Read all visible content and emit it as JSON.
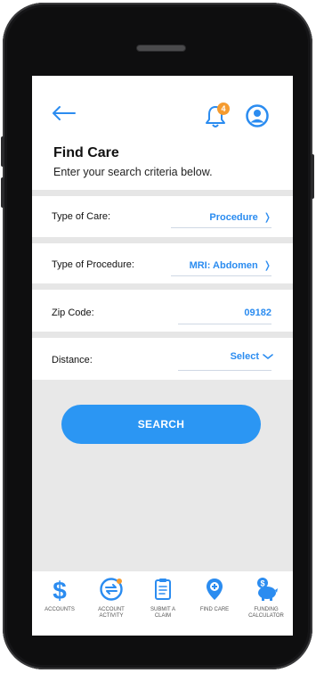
{
  "header": {
    "notification_count": "4",
    "title": "Find Care",
    "subtitle": "Enter your search criteria below."
  },
  "form": {
    "rows": [
      {
        "label": "Type of Care:",
        "value": "Procedure"
      },
      {
        "label": "Type of Procedure:",
        "value": "MRI: Abdomen"
      },
      {
        "label": "Zip Code:",
        "value": "09182"
      },
      {
        "label": "Distance:",
        "value": "Select"
      }
    ],
    "search_label": "SEARCH"
  },
  "nav": {
    "items": [
      {
        "label_line1": "ACCOUNTS",
        "label_line2": "",
        "icon": "dollar-icon"
      },
      {
        "label_line1": "ACCOUNT",
        "label_line2": "ACTIVITY",
        "icon": "account-activity-icon"
      },
      {
        "label_line1": "SUBMIT A",
        "label_line2": "CLAIM",
        "icon": "clipboard-icon"
      },
      {
        "label_line1": "FIND CARE",
        "label_line2": "",
        "icon": "location-pin-icon"
      },
      {
        "label_line1": "FUNDING",
        "label_line2": "CALCULATOR",
        "icon": "piggy-bank-icon"
      }
    ]
  },
  "colors": {
    "accent": "#2b8cf0",
    "button": "#2b96f3",
    "badge": "#f59b2f",
    "divider": "#e6e6e6",
    "background_gray": "#e8e8e8"
  }
}
